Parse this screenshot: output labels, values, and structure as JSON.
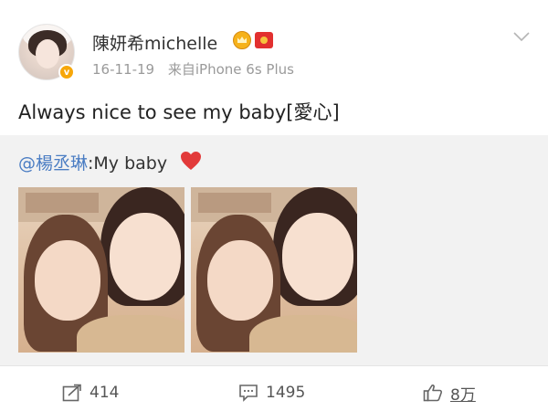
{
  "post": {
    "username": "陳妍希michelle",
    "date": "16-11-19",
    "source": "来自iPhone 6s Plus",
    "text": "Always nice to see my baby[愛心]",
    "verified_mark": "v"
  },
  "repost": {
    "mention": "@楊丞琳",
    "text": ":My baby"
  },
  "actions": {
    "repost_count": "414",
    "comment_count": "1495",
    "like_count": "8万"
  },
  "icons": {
    "crown": "crown-icon",
    "red_packet": "red-packet-icon",
    "heart": "heart-icon",
    "chevron": "chevron-down-icon",
    "repost": "repost-icon",
    "comment": "comment-icon",
    "like": "thumbs-up-icon"
  },
  "colors": {
    "mention": "#4b7dc3",
    "heart": "#e23a3a",
    "repost_bg": "#f2f2f2",
    "verified": "#f7a70a"
  }
}
